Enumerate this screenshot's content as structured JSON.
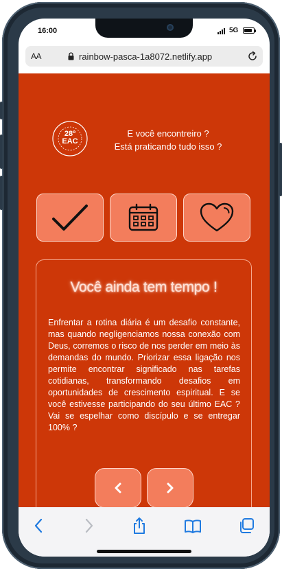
{
  "status_bar": {
    "time": "16:00",
    "network": "5G"
  },
  "browser": {
    "text_size_label": "AA",
    "url": "rainbow-pasca-1a8072.netlify.app"
  },
  "logo": {
    "text_number": "28º",
    "text_name": "EAC",
    "ring_text": "ENCONTRO DE ADOLESCENTES COM CRISTO"
  },
  "intro": {
    "line1": "E você encontreiro ?",
    "line2": "Está praticando tudo isso ?"
  },
  "tiles": [
    {
      "icon": "checkmark-icon"
    },
    {
      "icon": "calendar-icon"
    },
    {
      "icon": "heart-icon"
    }
  ],
  "card": {
    "title": "Você ainda tem tempo !",
    "body": "Enfrentar a rotina diária é um desafio constante, mas quando negligenciamos nossa conexão com Deus, corremos o risco de nos perder em meio às demandas do mundo. Priorizar essa ligação nos permite encontrar significado nas tarefas cotidianas, transformando desafios em oportunidades de crescimento espiritual. E se você estivesse participando do seu último EAC ? Vai se espelhar como discípulo e se entregar 100% ?",
    "prev_icon": "chevron-left-icon",
    "next_icon": "chevron-right-icon"
  },
  "toolbar": [
    "back-icon",
    "forward-icon",
    "share-icon",
    "bookmarks-icon",
    "tabs-icon"
  ],
  "colors": {
    "page_background": "#cd3708",
    "tile_background": "#f37d5c",
    "toolbar_accent": "#1f7ae0"
  }
}
